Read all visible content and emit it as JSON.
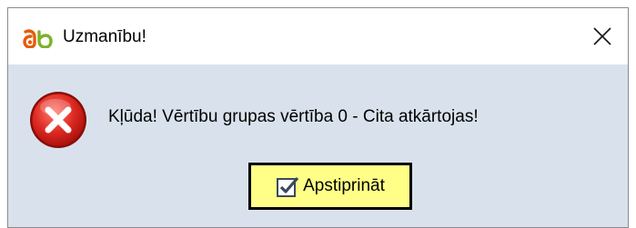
{
  "dialog": {
    "title": "Uzmanību!",
    "app_icon": "ab-logo",
    "close_icon": "close-icon",
    "message": "Kļūda! Vērtību grupas vērtība 0 - Cita atkārtojas!",
    "status_icon": "error-icon",
    "confirm_button": {
      "label": "Apstiprināt",
      "icon": "checkbox-checked-icon"
    }
  },
  "colors": {
    "dialog_body": "#d9e2ec",
    "titlebar": "#ffffff",
    "button_background": "#ffff88",
    "button_border": "#000000",
    "error_red": "#d9201c"
  }
}
